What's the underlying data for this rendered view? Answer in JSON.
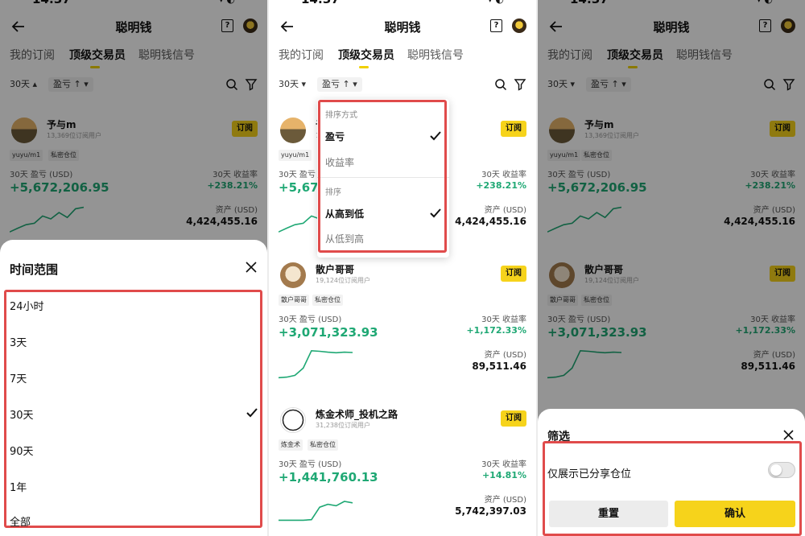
{
  "status": {
    "time": "14:37",
    "right": "▾  ◐"
  },
  "nav": {
    "title": "聪明钱",
    "help": "?"
  },
  "tabs": [
    "我的订阅",
    "顶级交易员",
    "聪明钱信号"
  ],
  "filters": {
    "range": "30天 ▴",
    "range_alt": "30天 ▾",
    "sort": "盈亏 ↑ ▾"
  },
  "labels": {
    "pnl": "30天 盈亏 (USD)",
    "roi": "30天 收益率",
    "assets": "资产 (USD)",
    "subscribe": "订阅"
  },
  "traders": [
    {
      "name": "予与m",
      "subs": "13,369位订阅用户",
      "tags": [
        "yuyu/m1",
        "私密仓位"
      ],
      "pnl": "+5,672,206.95",
      "roi": "+238.21%",
      "assets": "4,424,455.16",
      "spark": [
        0.05,
        0.18,
        0.3,
        0.35,
        0.6,
        0.5,
        0.72,
        0.55,
        0.85,
        0.9
      ]
    },
    {
      "name": "散户哥哥",
      "subs": "19,124位订阅用户",
      "tags": [
        "散户哥哥",
        "私密仓位"
      ],
      "pnl": "+3,071,323.93",
      "roi": "+1,172.33%",
      "assets": "89,511.46",
      "spark": [
        0.02,
        0.04,
        0.1,
        0.35,
        0.95,
        0.93,
        0.9,
        0.88,
        0.9,
        0.89
      ]
    },
    {
      "name": "炼金术师_投机之路",
      "subs": "31,238位订阅用户",
      "tags": [
        "炼金术",
        "私密仓位"
      ],
      "pnl": "+1,441,760.13",
      "roi": "+14.81%",
      "assets": "5,742,397.03",
      "spark": [
        0.1,
        0.1,
        0.1,
        0.1,
        0.12,
        0.55,
        0.65,
        0.6,
        0.75,
        0.7
      ]
    }
  ],
  "time_sheet": {
    "title": "时间范围",
    "options": [
      "24小时",
      "3天",
      "7天",
      "30天",
      "90天",
      "1年",
      "全部"
    ],
    "selected": "30天"
  },
  "sort_dropdown": {
    "section1": "排序方式",
    "items1": [
      "盈亏",
      "收益率"
    ],
    "section2": "排序",
    "items2": [
      "从高到低",
      "从低到高"
    ]
  },
  "filter_sheet": {
    "title": "筛选",
    "toggle_label": "仅展示已分享仓位",
    "toggle_on": false,
    "reset": "重置",
    "confirm": "确认"
  },
  "colors": {
    "accent": "#f6d31b",
    "positive": "#1fa874",
    "highlight": "#e04b4b"
  }
}
